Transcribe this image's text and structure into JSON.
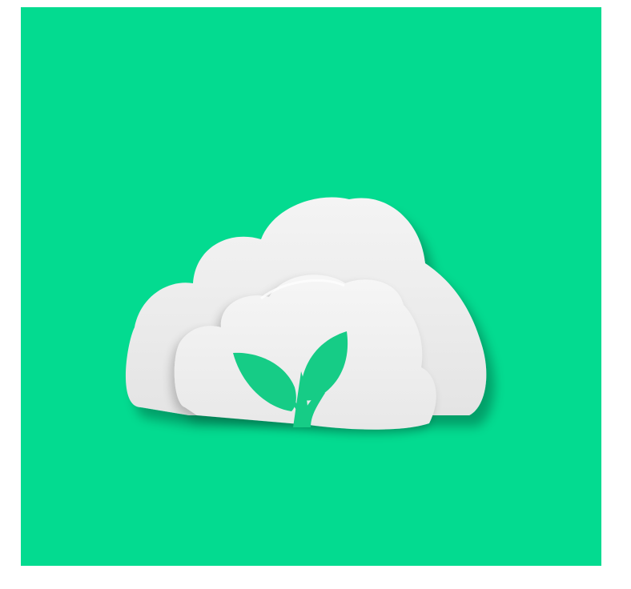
{
  "image": {
    "background_color": "#ffffff",
    "panel_color": "#03db90",
    "cloud_color": "#eeeeee",
    "cloud_shadow_color": "#cfcfcf",
    "leaf_color": "#16cc86",
    "icon": "cloud-with-sprout-icon"
  }
}
